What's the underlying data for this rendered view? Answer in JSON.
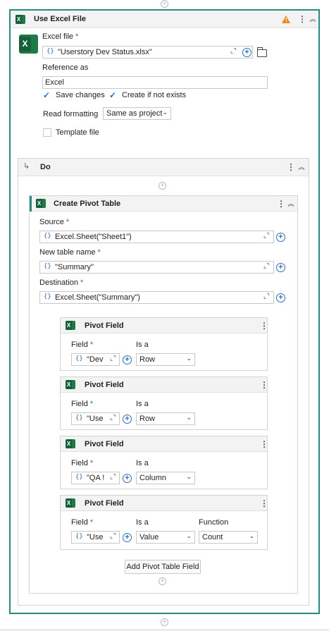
{
  "use_excel_file": {
    "title": "Use Excel File",
    "excel_file_label": "Excel file",
    "required_mark": "*",
    "excel_file_value": "\"Userstory Dev Status.xlsx\"",
    "reference_as_label": "Reference as",
    "reference_as_value": "Excel",
    "save_changes_label": "Save changes",
    "save_changes_checked": true,
    "create_if_not_exists_label": "Create if not exists",
    "create_if_not_exists_checked": true,
    "read_formatting_label": "Read formatting",
    "read_formatting_value": "Same as project",
    "template_file_label": "Template file",
    "template_file_checked": false
  },
  "do_block": {
    "title": "Do"
  },
  "create_pivot_table": {
    "title": "Create Pivot Table",
    "source_label": "Source",
    "source_value": "Excel.Sheet(\"Sheet1\")",
    "new_table_name_label": "New table name",
    "new_table_name_value": "\"Summary\"",
    "destination_label": "Destination",
    "destination_value": "Excel.Sheet(\"Summary\")",
    "add_field_button": "Add Pivot Table Field"
  },
  "pivot_fields": [
    {
      "title": "Pivot Field",
      "field_label": "Field",
      "field_value": "\"Dev",
      "is_a_label": "Is a",
      "is_a_value": "Row"
    },
    {
      "title": "Pivot Field",
      "field_label": "Field",
      "field_value": "\"Use",
      "is_a_label": "Is a",
      "is_a_value": "Row"
    },
    {
      "title": "Pivot Field",
      "field_label": "Field",
      "field_value": "\"QA !",
      "is_a_label": "Is a",
      "is_a_value": "Column"
    },
    {
      "title": "Pivot Field",
      "field_label": "Field",
      "field_value": "\"Use",
      "is_a_label": "Is a",
      "is_a_value": "Value",
      "function_label": "Function",
      "function_value": "Count"
    }
  ],
  "icons": {
    "excel": "excel-icon",
    "warning": "warning-icon",
    "kebab": "more-options-icon",
    "collapse": "collapse-icon",
    "expand": "expand-editor-icon",
    "add": "add-variable-icon",
    "folder": "browse-folder-icon",
    "insert": "insert-activity-icon",
    "branch": "branch-arrow-icon"
  },
  "colors": {
    "accent": "#2a8a7b",
    "excel_green": "#1f7a46",
    "link_blue": "#1f6fc5",
    "warning": "#e48a1e"
  }
}
